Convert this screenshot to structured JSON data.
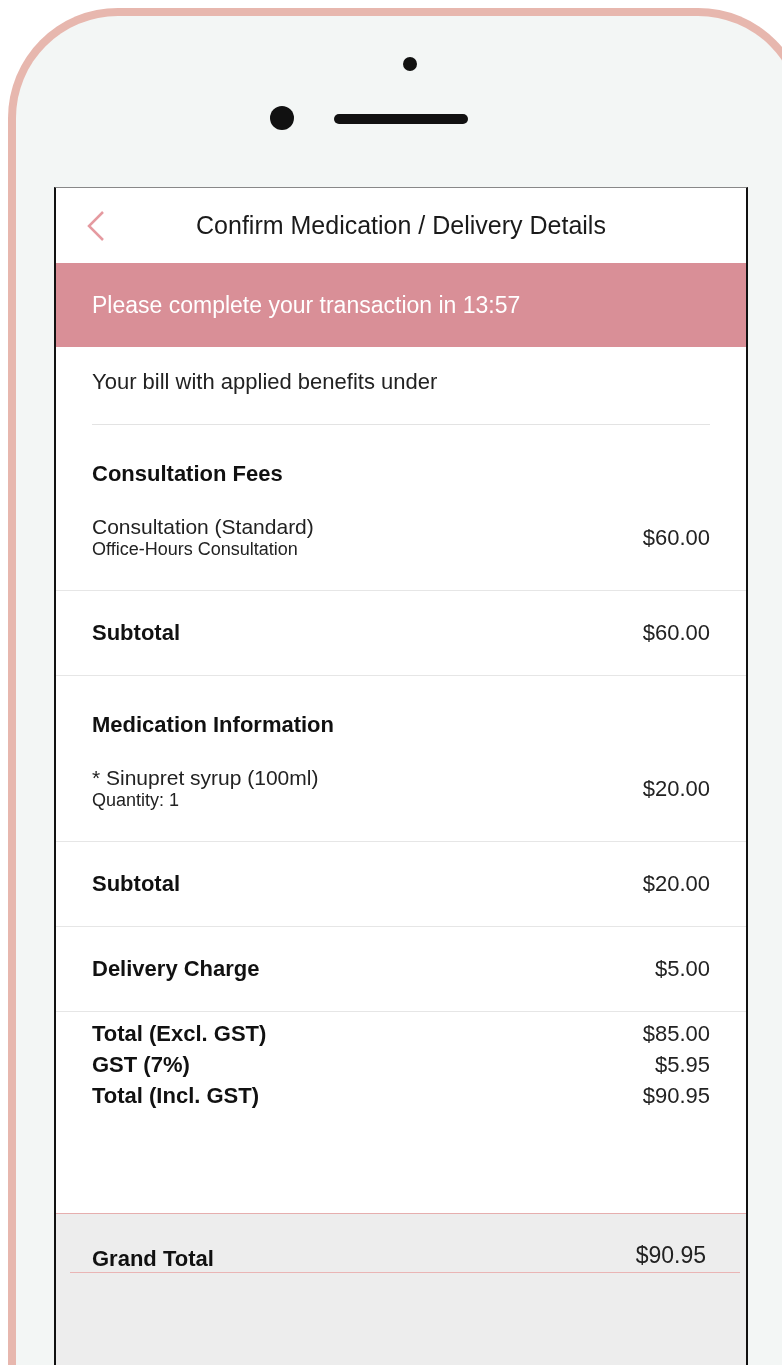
{
  "header": {
    "title": "Confirm Medication / Delivery Details"
  },
  "banner": {
    "text": "Please complete your transaction in 13:57"
  },
  "intro": "Your bill with applied benefits under",
  "sections": [
    {
      "kind": "group",
      "heading": "Consultation Fees",
      "items": [
        {
          "name": "Consultation (Standard)",
          "detail": "Office-Hours Consultation",
          "price": "$60.00"
        }
      ]
    },
    {
      "kind": "summary",
      "label": "Subtotal",
      "amount": "$60.00"
    },
    {
      "kind": "group",
      "heading": "Medication Information",
      "items": [
        {
          "name": "* Sinupret syrup (100ml)",
          "detail": "Quantity: 1",
          "price": "$20.00"
        }
      ]
    },
    {
      "kind": "summary",
      "label": "Subtotal",
      "amount": "$20.00"
    },
    {
      "kind": "summary",
      "label": "Delivery Charge",
      "amount": "$5.00"
    },
    {
      "kind": "totals",
      "lines": [
        {
          "label": "Total (Excl. GST)",
          "amount": "$85.00"
        },
        {
          "label": "GST (7%)",
          "amount": "$5.95"
        },
        {
          "label": "Total (Incl. GST)",
          "amount": "$90.95"
        }
      ]
    }
  ],
  "grand_total": {
    "label": "Grand Total",
    "amount": "$90.95"
  }
}
